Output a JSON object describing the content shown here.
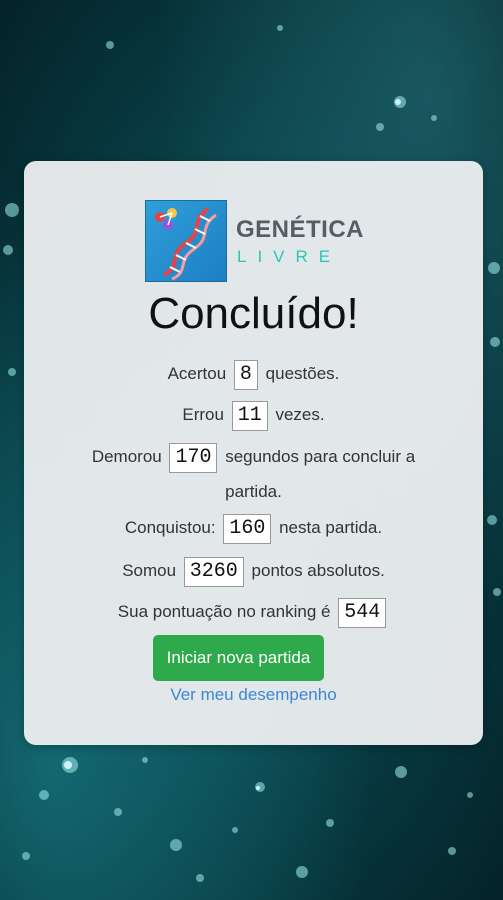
{
  "brand": {
    "title": "GENÉTICA",
    "subtitle": "LIVRE"
  },
  "result": {
    "heading": "Concluído!",
    "correct": {
      "prefix": "Acertou",
      "value": "8",
      "suffix": "questões."
    },
    "wrong": {
      "prefix": "Errou",
      "value": "11",
      "suffix": "vezes."
    },
    "time": {
      "prefix": "Demorou",
      "value": "170",
      "suffix": "segundos para concluir a",
      "suffix2": "partida."
    },
    "earned": {
      "prefix": "Conquistou:",
      "value": "160",
      "suffix": "nesta partida."
    },
    "total": {
      "prefix": "Somou",
      "value": "3260",
      "suffix": "pontos absolutos."
    },
    "ranking": {
      "prefix": "Sua pontuação no ranking é",
      "value": "544"
    }
  },
  "actions": {
    "new_game_label": "Iniciar nova partida",
    "performance_link": "Ver meu desempenho"
  },
  "colors": {
    "button": "#2ea94b",
    "link": "#3d86d6",
    "brand_sub": "#2cc6b2"
  }
}
